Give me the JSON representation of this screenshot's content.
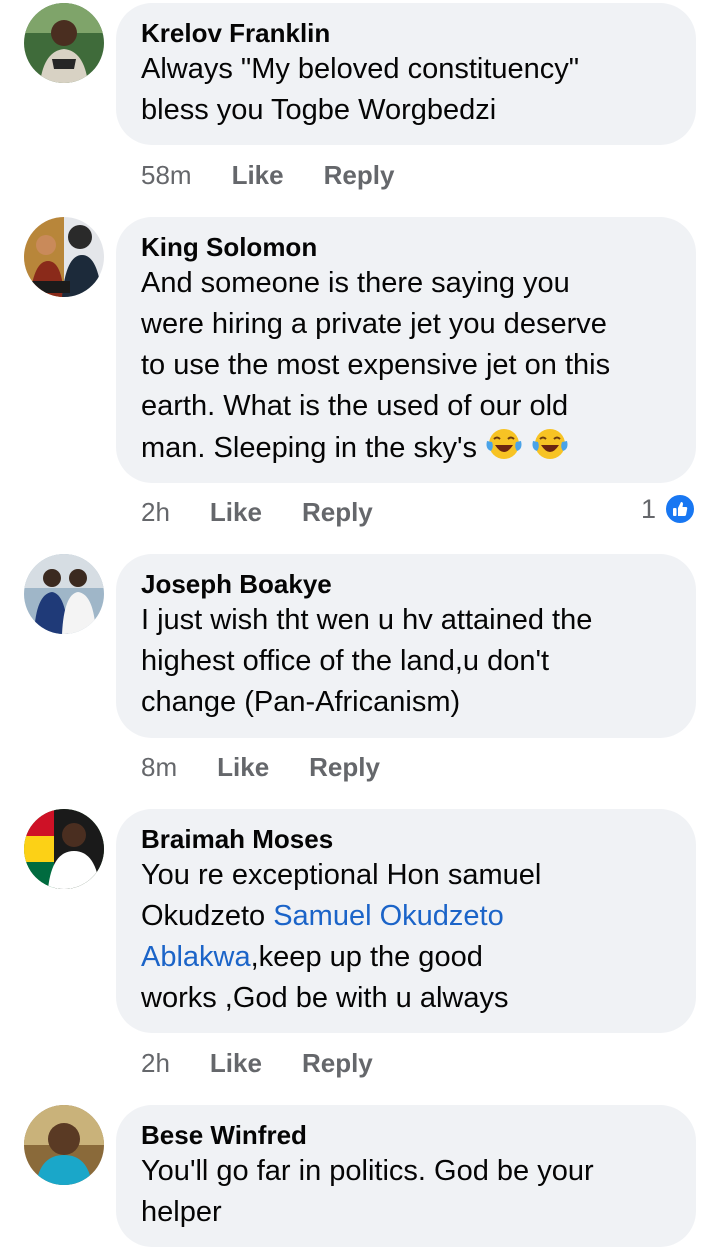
{
  "comments": [
    {
      "author": "Krelov Franklin",
      "lines": [
        "Always \"My beloved constituency\"",
        "bless you Togbe Worgbedzi"
      ],
      "time": "58m",
      "like": "Like",
      "reply": "Reply"
    },
    {
      "author": "King Solomon",
      "lines": [
        "And someone is there saying you",
        "were hiring a private jet you deserve",
        "to use the most expensive jet on this",
        "earth. What is the used of our old",
        "man. Sleeping in the sky's"
      ],
      "emoji": [
        "face-with-tears-of-joy",
        "face-with-tears-of-joy"
      ],
      "time": "2h",
      "like": "Like",
      "reply": "Reply",
      "reaction_count": "1",
      "reaction_icon": "like-icon"
    },
    {
      "author": "Joseph Boakye",
      "lines": [
        "I just wish tht wen u hv attained the",
        "highest office of the land,u don't",
        "change (Pan-Africanism)"
      ],
      "time": "8m",
      "like": "Like",
      "reply": "Reply"
    },
    {
      "author": "Braimah Moses",
      "line1": "You re exceptional Hon samuel",
      "line2_text": "Okudzeto ",
      "mention_part1": "Samuel Okudzeto",
      "mention_part2": "Ablakwa",
      "line3_rest": ",keep up the good",
      "line4": "works ,God be with u always",
      "time": "2h",
      "like": "Like",
      "reply": "Reply"
    },
    {
      "author": "Bese Winfred",
      "lines": [
        "You'll go far in politics. God be your",
        "helper"
      ]
    }
  ],
  "colors": {
    "bubble": "#f0f2f5",
    "mention": "#1b64c8",
    "meta": "#65676b",
    "like_badge": "#1877f2"
  }
}
